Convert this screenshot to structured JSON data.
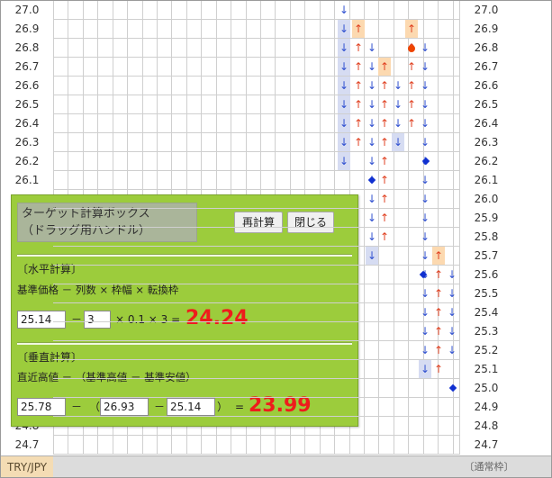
{
  "rows": [
    "27.0",
    "26.9",
    "26.8",
    "26.7",
    "26.6",
    "26.5",
    "26.4",
    "26.3",
    "26.2",
    "26.1",
    "26.0",
    "25.9",
    "25.8",
    "25.7",
    "25.6",
    "25.5",
    "25.4",
    "25.3",
    "25.2",
    "25.1",
    "25.0",
    "24.9",
    "24.8",
    "24.7"
  ],
  "footer": {
    "pair": "TRY/JPY",
    "mode": "〔通常枠〕"
  },
  "calc": {
    "handle_line1": "ターゲット計算ボックス",
    "handle_line2": "（ドラッグ用ハンドル）",
    "recalc_label": "再計算",
    "close_label": "閉じる",
    "horizontal": {
      "title": "〔水平計算〕",
      "formula": "基準価格 － 列数 × 枠幅 × 転換枠",
      "base_price": "25.14",
      "columns": "3",
      "minus": "－",
      "rest": "× 0.1 × 3 =",
      "result": "24.24"
    },
    "vertical": {
      "title": "〔垂直計算〕",
      "formula": "直近高値 － （基準高値 － 基準安値）",
      "recent_high": "25.78",
      "base_high": "26.93",
      "base_low": "25.14",
      "minus": "－",
      "open_paren": "（",
      "inner_minus": "－",
      "close_paren": "）",
      "equals": "=",
      "result": "23.99"
    }
  },
  "colors": {
    "up": "#e04020",
    "down": "#3050d0",
    "calc_bg": "#9ccc3c",
    "result": "#ee1c1c"
  },
  "icons": {
    "up": "↑",
    "down": "↓"
  }
}
